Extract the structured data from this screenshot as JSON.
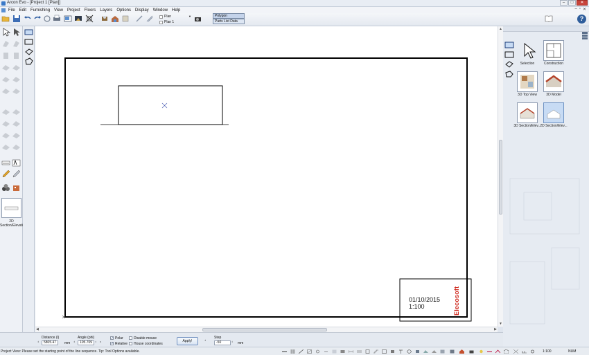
{
  "window": {
    "title": "Arcon Evo - [Project 1 [Plan]]",
    "controls": {
      "minimize": "–",
      "maximize": "□",
      "close": "✕"
    }
  },
  "menubar": {
    "items": [
      "File",
      "Edit",
      "Furnishing",
      "View",
      "Project",
      "Floors",
      "Layers",
      "Options",
      "Display",
      "Window",
      "Help"
    ],
    "mdi": {
      "minimize": "–",
      "restore": "▫",
      "close": "✕"
    }
  },
  "toolbar": {
    "plan_select": {
      "items": [
        "Plan",
        "Plan 1"
      ]
    },
    "mode_list": [
      "Polygon",
      "Parts List Data"
    ],
    "help_label": "?"
  },
  "left_panel": {
    "current_view_label": "2D Section/Elevation"
  },
  "right_panel": {
    "tiles": [
      {
        "label": "Selection"
      },
      {
        "label": "Construction"
      },
      {
        "label": "3D Top View"
      },
      {
        "label": "3D Model"
      },
      {
        "label": "3D Section/Elev..."
      },
      {
        "label": "2D Section/Elev...",
        "selected": true
      }
    ]
  },
  "drawing": {
    "stamp_date": "01/10/2015",
    "stamp_scale": "1:100",
    "stamp_logo": "Elecosoft"
  },
  "options_bar": {
    "distance_label": "Distance (l)",
    "distance_value": "5805.47",
    "distance_unit": "mm",
    "angle_label": "Angle (phi)",
    "angle_value": "105.709",
    "angle_unit": "°",
    "polar_label": "Polar",
    "polar_checked": true,
    "relative_label": "Relative",
    "relative_checked": true,
    "disable_mouse_label": "Disable mouse",
    "house_coords_label": "House coordinates",
    "apply_label": "Apply!",
    "step_label": "Step",
    "step_value": "-50",
    "step_unit": "mm"
  },
  "statusbar": {
    "text": "Project View: Please set the starting point of the line sequence. Tip: Tool Options available.",
    "scale": "1:100",
    "num": "NUM"
  },
  "colors": {
    "accent": "#2f5e9c",
    "selection": "#c7dbf4",
    "logo_red": "#d02a1f"
  }
}
